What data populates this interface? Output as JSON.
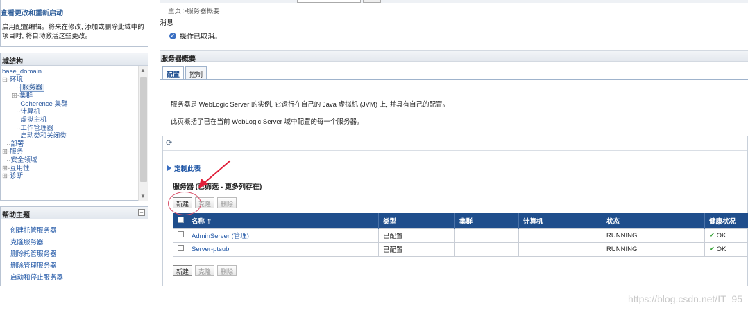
{
  "change_center": {
    "title": "查看更改和重新启动",
    "text": "启用配置编辑。将来在修改, 添加或删除此域中的项目时, 将自动激活这些更改。"
  },
  "domain_structure": {
    "title": "域结构",
    "items": [
      "base_domain",
      "环境",
      "服务器",
      "集群",
      "Coherence 集群",
      "计算机",
      "虚拟主机",
      "工作管理器",
      "启动类和关闭类",
      "部署",
      "服务",
      "安全领域",
      "互用性",
      "诊断"
    ]
  },
  "help": {
    "title": "帮助主题",
    "links": [
      "创建托管服务器",
      "克隆服务器",
      "删除托管服务器",
      "删除管理服务器",
      "启动和停止服务器"
    ]
  },
  "breadcrumb": "主页 >服务器概要",
  "messages": {
    "title": "消息",
    "text": "操作已取消。"
  },
  "section_title": "服务器概要",
  "tabs": [
    "配置",
    "控制"
  ],
  "description": {
    "line1": "服务器是 WebLogic Server 的实例, 它运行在自己的 Java 虚拟机 (JVM) 上, 并具有自己的配置。",
    "line2": "此页概括了已在当前 WebLogic Server 域中配置的每一个服务器。"
  },
  "customize_label": "定制此表",
  "table_title": "服务器 (已筛选 - 更多列存在)",
  "buttons": {
    "new": "新建",
    "clone": "克隆",
    "delete": "删除"
  },
  "table": {
    "headers": [
      "名称 ⇑",
      "类型",
      "集群",
      "计算机",
      "状态",
      "健康状况"
    ],
    "rows": [
      [
        "AdminServer (管理)",
        "已配置",
        "",
        "",
        "RUNNING",
        "OK"
      ],
      [
        "Server-ptsub",
        "已配置",
        "",
        "",
        "RUNNING",
        "OK"
      ]
    ]
  },
  "watermark": "https://blog.csdn.net/IT_95",
  "colors": {
    "header_blue": "#1f4e8c",
    "link_blue": "#1f56a6",
    "annotation_red": "#e0203a",
    "ok_green": "#2a9c2a"
  }
}
